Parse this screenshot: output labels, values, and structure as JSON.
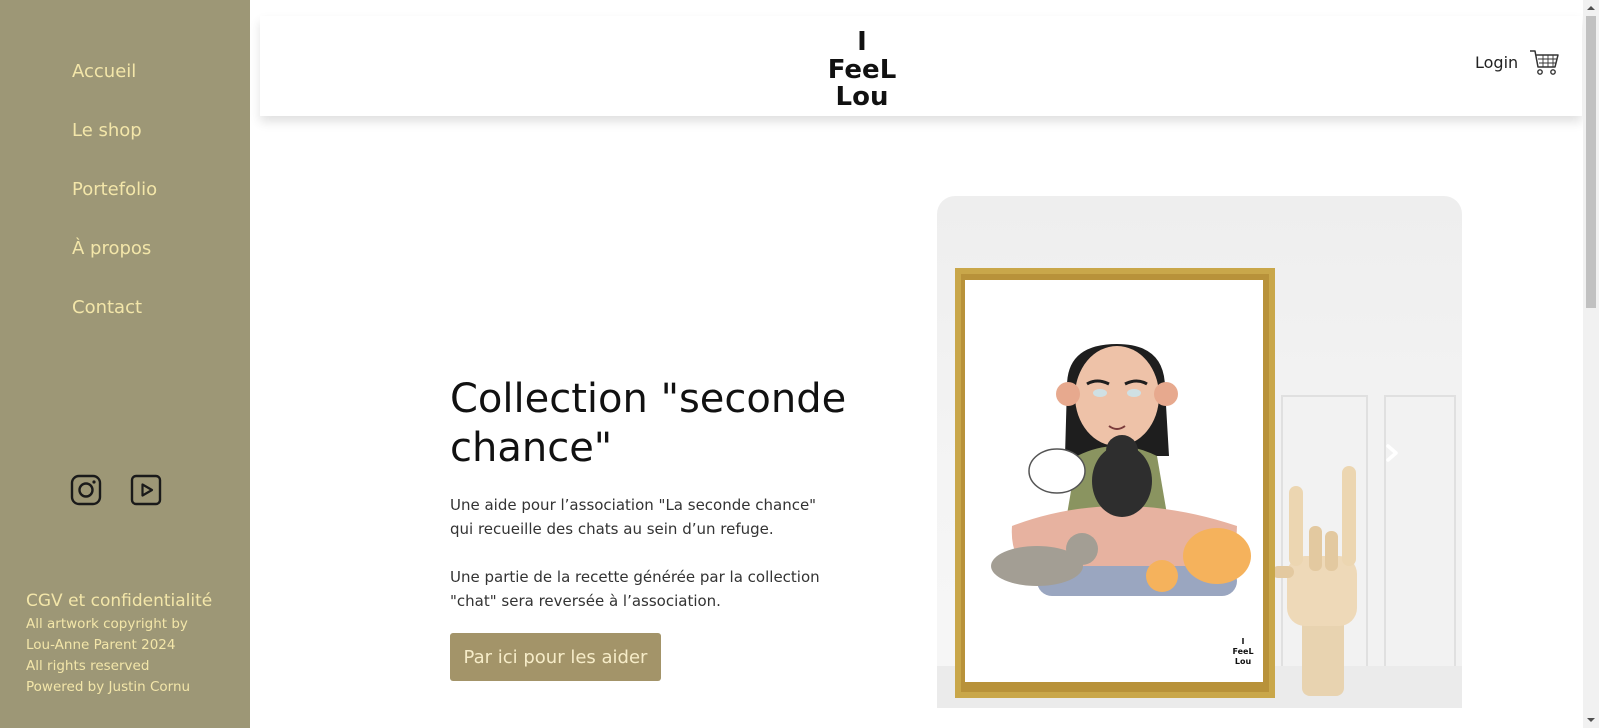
{
  "sidebar": {
    "nav": [
      {
        "label": "Accueil"
      },
      {
        "label": "Le shop"
      },
      {
        "label": "Portefolio"
      },
      {
        "label": "À propos"
      },
      {
        "label": "Contact"
      }
    ],
    "social": [
      "instagram-icon",
      "youtube-icon"
    ],
    "footer": {
      "link": "CGV et confidentialité",
      "lines": [
        "All artwork copyright by",
        "Lou-Anne Parent 2024",
        "All rights reserved",
        "Powered by Justin Cornu"
      ]
    }
  },
  "header": {
    "logo_text": {
      "line1": "I",
      "line2": "FeeL",
      "line3": "Lou"
    },
    "login_label": "Login",
    "cart_icon": "cart-icon"
  },
  "hero": {
    "title": "Collection \"seconde chance\"",
    "paragraph1": "Une aide pour l’association \"La seconde chance\" qui recueille des chats au sein d’un refuge.",
    "paragraph2": "Une partie de la recette générée par la collection \"chat\" sera reversée à l’association.",
    "cta_label": "Par ici pour les aider",
    "frame_signature": {
      "line1": "I",
      "line2": "FeeL",
      "line3": "Lou"
    }
  },
  "colors": {
    "sidebar_bg": "#9d9776",
    "sidebar_text": "#f3e6a9",
    "cta_bg": "#a39469",
    "frame_gold": "#c9a74a"
  }
}
